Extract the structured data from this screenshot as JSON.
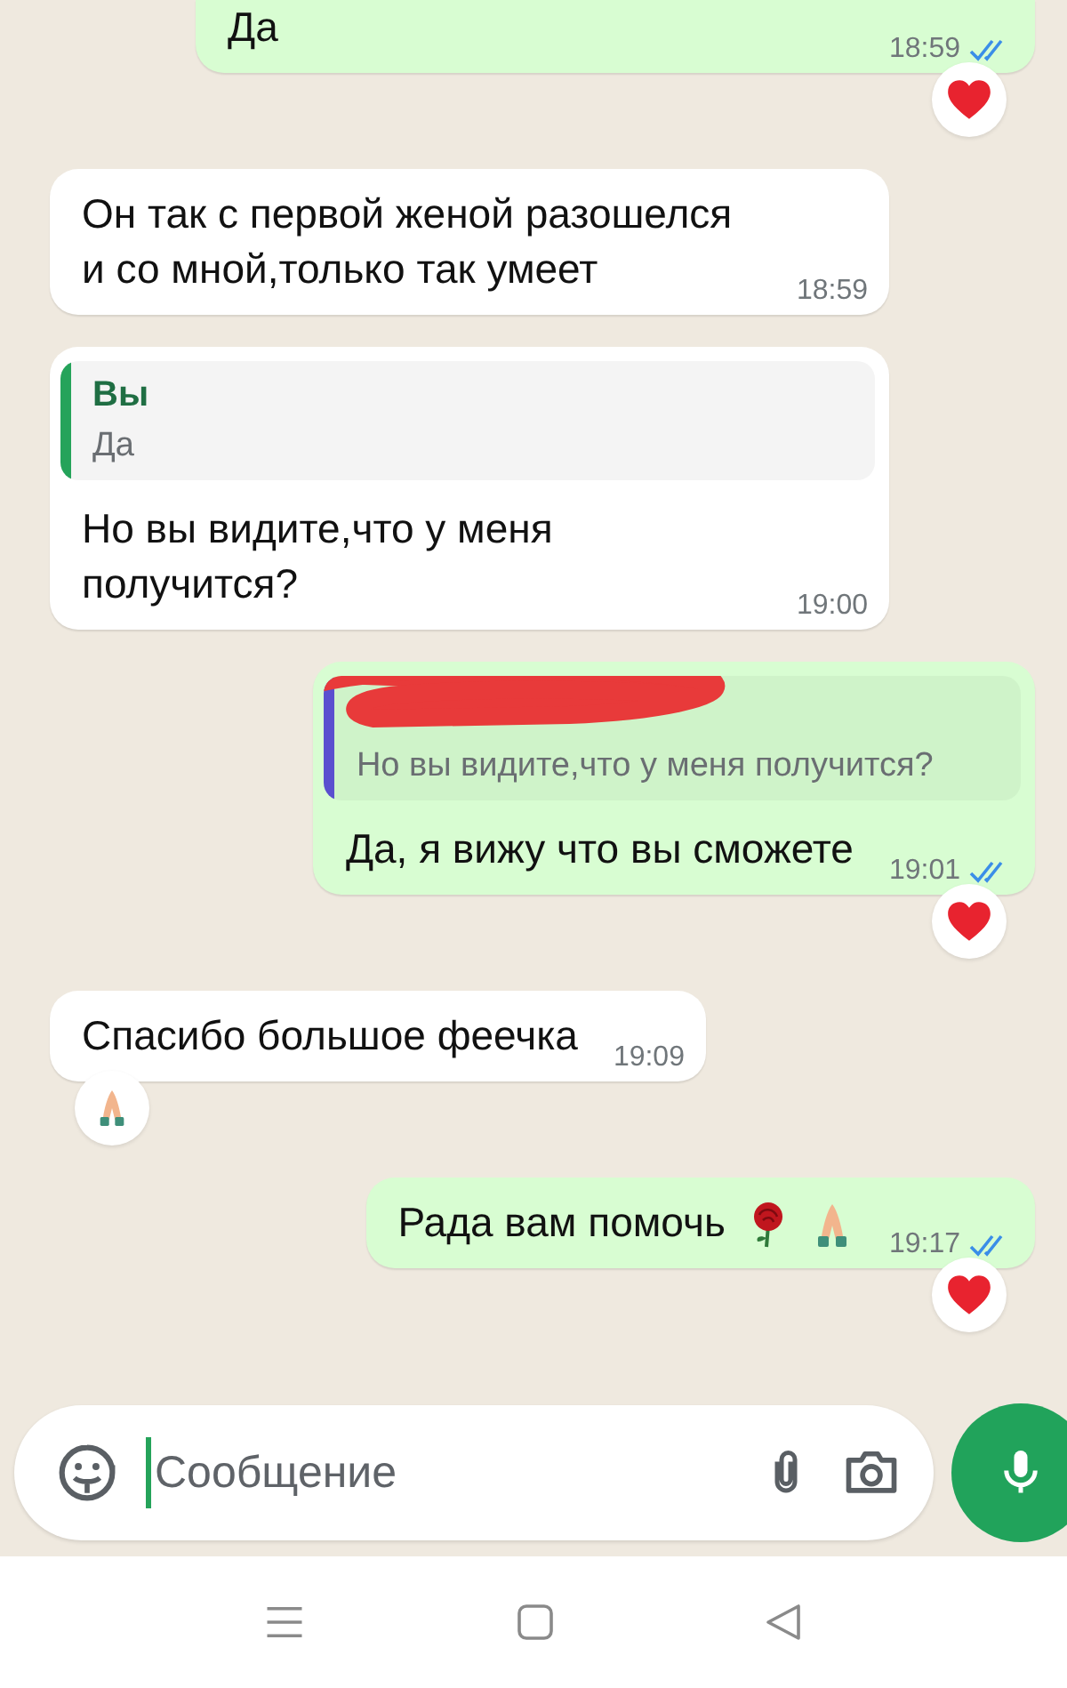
{
  "messages": [
    {
      "kind": "out",
      "text": "Да",
      "time": "18:59",
      "read": true,
      "reaction": {
        "kind": "heart"
      }
    },
    {
      "kind": "in",
      "text": "Он так с первой женой разошелся и со мной,только так умеет",
      "time": "18:59"
    },
    {
      "kind": "in",
      "quote": {
        "author": "Вы",
        "text": "Да",
        "color": "#25a35a"
      },
      "text": "Но вы видите,что у меня получится?",
      "time": "19:00"
    },
    {
      "kind": "out",
      "quote": {
        "redacted": true,
        "text": "Но вы видите,что у меня получится?",
        "color": "#5a4fcf"
      },
      "text": "Да, я вижу что вы сможете",
      "time": "19:01",
      "read": true,
      "reaction": {
        "kind": "heart"
      }
    },
    {
      "kind": "in",
      "text": "Спасибо большое феечка",
      "time": "19:09",
      "reaction": {
        "kind": "pray"
      }
    },
    {
      "kind": "out",
      "text": "Рада вам помочь",
      "inline_icons": [
        {
          "kind": "rose"
        },
        {
          "kind": "pray"
        }
      ],
      "time": "19:17",
      "read": true,
      "reaction": {
        "kind": "heart"
      }
    }
  ],
  "composer": {
    "placeholder": "Сообщение"
  }
}
